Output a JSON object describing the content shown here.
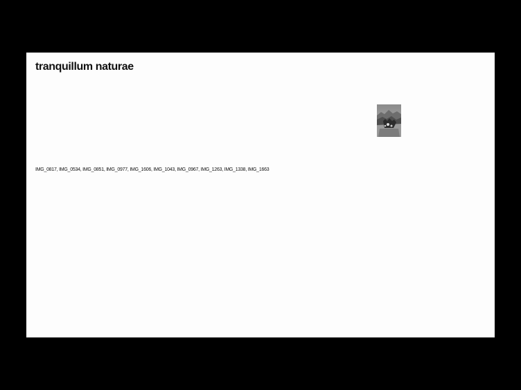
{
  "site": {
    "title": "tranquillum naturae"
  },
  "featured_image": {
    "icon": "mountain-landscape-photo",
    "tone": "grayscale"
  },
  "image_list": {
    "items": [
      "IMG_0817",
      "IMG_0534",
      "IMG_0851",
      "IMG_0977",
      "IMG_1606",
      "IMG_1043",
      "IMG_0967",
      "IMG_1263",
      "IMG_1338",
      "IMG_1663"
    ],
    "separator": ", "
  },
  "colors": {
    "frame": "#000000",
    "page": "#fdfdfd",
    "text": "#111111"
  }
}
